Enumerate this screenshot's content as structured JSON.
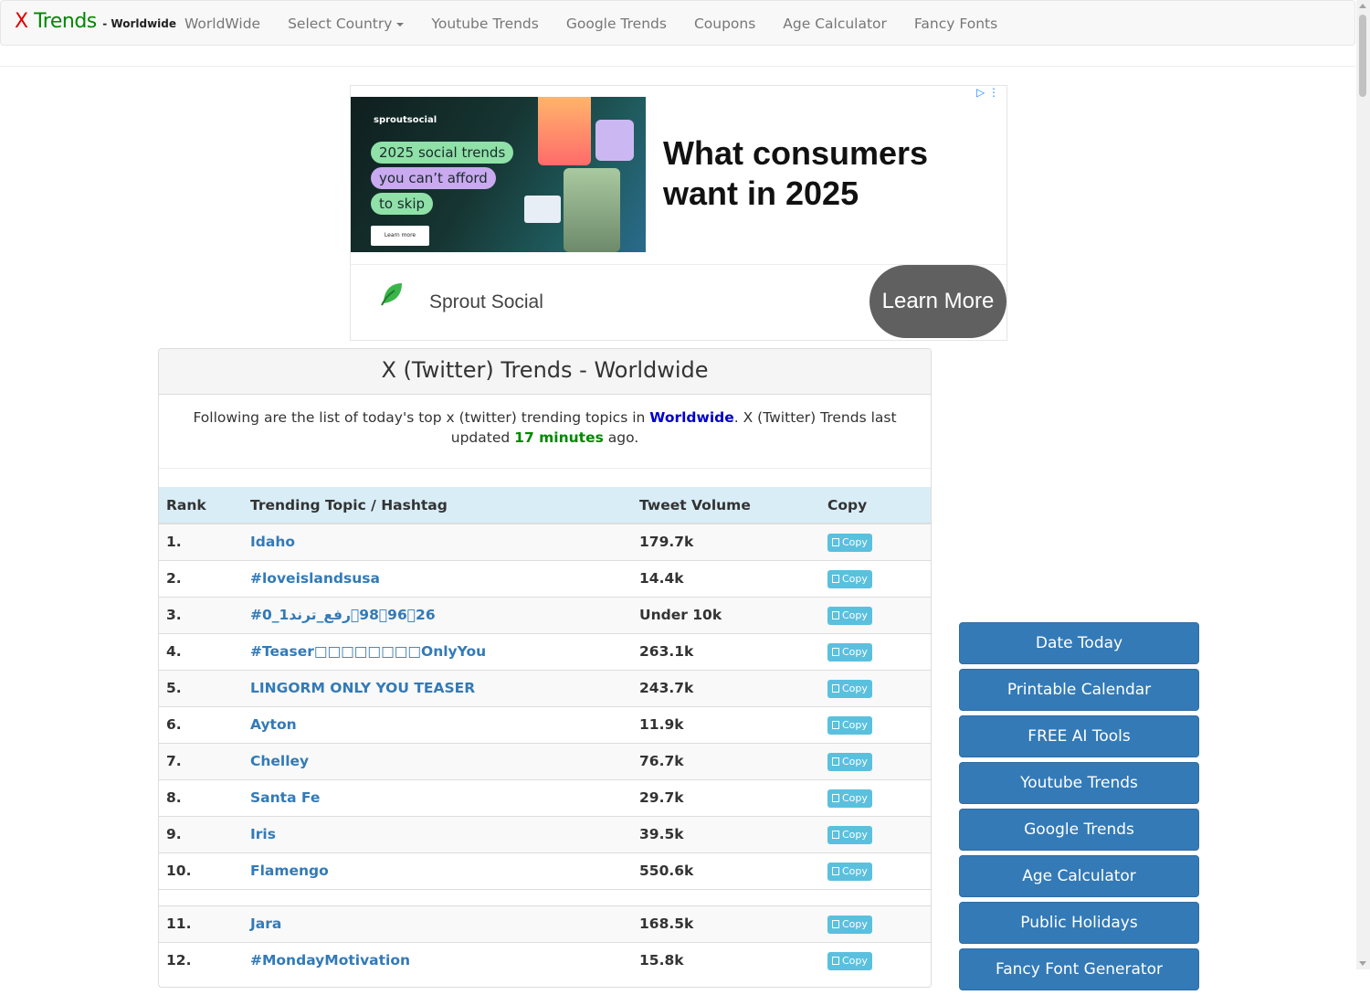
{
  "nav": {
    "brand_x": "X",
    "brand_trends": "Trends",
    "brand_region": "- Worldwide",
    "links": [
      "WorldWide",
      "Select Country",
      "Youtube Trends",
      "Google Trends",
      "Coupons",
      "Age Calculator",
      "Fancy Fonts"
    ]
  },
  "ad": {
    "image_brand": "sproutsocial",
    "image_pills": [
      "2025 social trends",
      "you can’t afford",
      "to skip"
    ],
    "image_button": "Learn more",
    "headline": "What consumers want in 2025",
    "advertiser": "Sprout Social",
    "cta": "Learn More"
  },
  "panel": {
    "title": "X (Twitter) Trends - Worldwide",
    "desc_prefix": "Following are the list of today's top x (twitter) trending topics in ",
    "desc_country": "Worldwide",
    "desc_middle": ". X (Twitter) Trends last updated ",
    "desc_minutes": "17 minutes",
    "desc_suffix": " ago.",
    "columns": [
      "Rank",
      "Trending Topic / Hashtag",
      "Tweet Volume",
      "Copy"
    ],
    "copy_label": "Copy",
    "rows": [
      {
        "rank": "1.",
        "topic": "Idaho",
        "volume": "179.7k"
      },
      {
        "rank": "2.",
        "topic": "#loveislandsusa",
        "volume": "14.4k"
      },
      {
        "rank": "3.",
        "topic": "#رفع_ترند1_0􏰀98􏰀96􏰀26",
        "volume": "Under 10k"
      },
      {
        "rank": "4.",
        "topic": "#Teaser□□□□□□□□OnlyYou",
        "volume": "263.1k"
      },
      {
        "rank": "5.",
        "topic": "LINGORM ONLY YOU TEASER",
        "volume": "243.7k"
      },
      {
        "rank": "6.",
        "topic": "Ayton",
        "volume": "11.9k"
      },
      {
        "rank": "7.",
        "topic": "Chelley",
        "volume": "76.7k"
      },
      {
        "rank": "8.",
        "topic": "Santa Fe",
        "volume": "29.7k"
      },
      {
        "rank": "9.",
        "topic": "Iris",
        "volume": "39.5k"
      },
      {
        "rank": "10.",
        "topic": "Flamengo",
        "volume": "550.6k"
      }
    ],
    "rows2": [
      {
        "rank": "11.",
        "topic": "Jara",
        "volume": "168.5k"
      },
      {
        "rank": "12.",
        "topic": "#MondayMotivation",
        "volume": "15.8k"
      }
    ]
  },
  "sidebar": {
    "buttons": [
      "Date Today",
      "Printable Calendar",
      "FREE AI Tools",
      "Youtube Trends",
      "Google Trends",
      "Age Calculator",
      "Public Holidays",
      "Fancy Font Generator"
    ]
  },
  "colors": {
    "brand_x": "#e00000",
    "brand_trends": "#008800",
    "link": "#337ab7",
    "table_header": "#d9edf7",
    "copy_button": "#5bc0de",
    "sidebar_button": "#337ab7"
  }
}
